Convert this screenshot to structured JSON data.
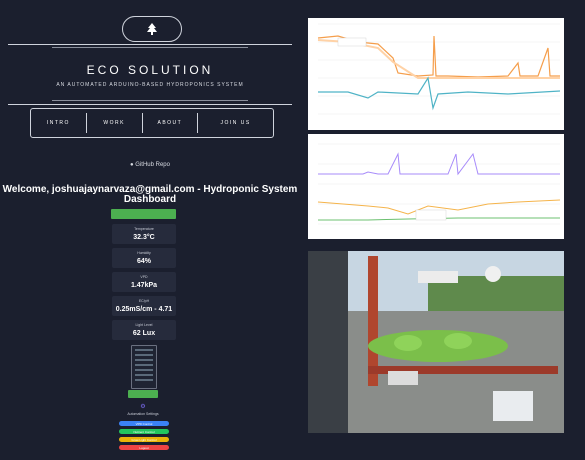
{
  "brand": {
    "title": "ECO SOLUTION",
    "tagline": "AN AUTOMATED ARDUINO-BASED HYDROPONICS SYSTEM"
  },
  "nav": [
    {
      "label": "INTRO"
    },
    {
      "label": "WORK"
    },
    {
      "label": "ABOUT"
    },
    {
      "label": "JOIN US"
    }
  ],
  "repo": {
    "label": "GitHub Repo",
    "icon": "github-icon"
  },
  "dashboard": {
    "welcome": "Welcome, joshuajaynarvaza@gmail.com - Hydroponic System Dashboard",
    "sensors": [
      {
        "label": "Temperature",
        "value": "32.3°C"
      },
      {
        "label": "Humidity",
        "value": "64%"
      },
      {
        "label": "VPD",
        "value": "1.47kPa"
      },
      {
        "label": "EC/pH",
        "value": "0.25mS/cm - 4.71"
      },
      {
        "label": "Light Level",
        "value": "62 Lux"
      }
    ],
    "toggles": [
      {
        "label": "VPD Control",
        "color": "#3b82f6"
      },
      {
        "label": "Nutrient Control",
        "color": "#22c55e"
      },
      {
        "label": "Grow Light Control",
        "color": "#eab308"
      },
      {
        "label": "Logout",
        "color": "#ef4444"
      }
    ],
    "automation_label": "Automation Settings"
  },
  "colors": {
    "background": "#1b1f2e",
    "card": "#262b3c",
    "accent_green": "#4caf50"
  },
  "photo": {
    "subject": "hydroponic grow system with lettuce plants"
  }
}
